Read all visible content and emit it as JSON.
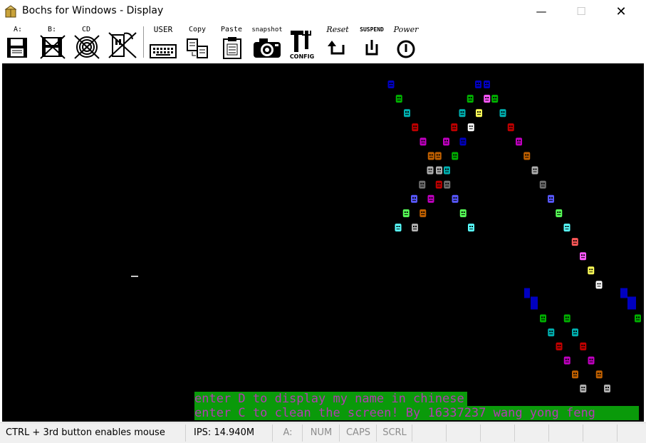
{
  "window": {
    "title": "Bochs for Windows - Display"
  },
  "toolbar": {
    "floppy_a": "A:",
    "floppy_b": "B:",
    "cdrom": "CD",
    "user": "USER",
    "copy": "Copy",
    "paste": "Paste",
    "snapshot": "snapshot",
    "config": "CONFIG",
    "reset": "Reset",
    "suspend": "SUSPEND",
    "power": "Power"
  },
  "screen": {
    "line1": "enter D to display my name in chinese",
    "line2": "enter C to clean the screen! By 16337237 wang yong feng",
    "text_color": "#b23bb2",
    "highlight_color": "#0a9a0a"
  },
  "statusbar": {
    "mouse_hint": "CTRL + 3rd button enables mouse",
    "ips": "IPS: 14.940M",
    "drive": "A:",
    "num": "NUM",
    "caps": "CAPS",
    "scrl": "SCRL"
  }
}
